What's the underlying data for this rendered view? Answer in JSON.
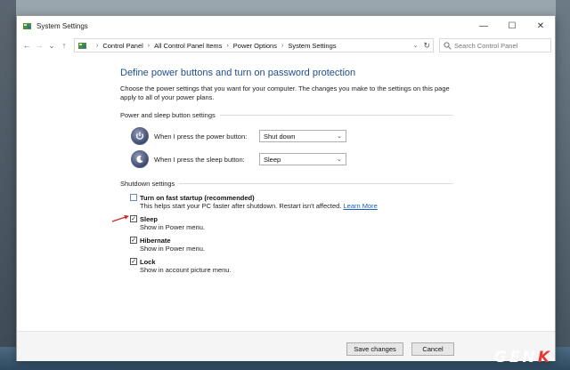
{
  "window": {
    "title": "System Settings",
    "minimize_glyph": "—",
    "maximize_glyph": "☐",
    "close_glyph": "✕"
  },
  "nav": {
    "back_glyph": "←",
    "forward_glyph": "→",
    "dropdown_glyph": "⌄",
    "up_glyph": "↑",
    "crumb_sep": "›",
    "breadcrumb": [
      "Control Panel",
      "All Control Panel Items",
      "Power Options",
      "System Settings"
    ],
    "address_dropdown_glyph": "⌄",
    "refresh_glyph": "↻",
    "search_placeholder": "Search Control Panel"
  },
  "page": {
    "heading": "Define power buttons and turn on password protection",
    "intro": "Choose the power settings that you want for your computer. The changes you make to the settings on this page apply to all of your power plans."
  },
  "power_sleep": {
    "section_title": "Power and sleep button settings",
    "power_button_label": "When I press the power button:",
    "power_button_value": "Shut down",
    "sleep_button_label": "When I press the sleep button:",
    "sleep_button_value": "Sleep",
    "select_arrow": "⌄"
  },
  "shutdown": {
    "section_title": "Shutdown settings",
    "check_glyph": "✓",
    "options": [
      {
        "name": "Turn on fast startup (recommended)",
        "checked": false,
        "desc": "This helps start your PC faster after shutdown. Restart isn't affected.",
        "link": "Learn More"
      },
      {
        "name": "Sleep",
        "checked": true,
        "desc": "Show in Power menu."
      },
      {
        "name": "Hibernate",
        "checked": true,
        "desc": "Show in Power menu."
      },
      {
        "name": "Lock",
        "checked": true,
        "desc": "Show in account picture menu."
      }
    ]
  },
  "footer": {
    "save_label": "Save changes",
    "cancel_label": "Cancel"
  },
  "watermark": {
    "main": "GEN",
    "accent": "K"
  },
  "colors": {
    "heading": "#1e4e8c",
    "link": "#1a5fb4",
    "annotation_arrow": "#d32f2f"
  }
}
